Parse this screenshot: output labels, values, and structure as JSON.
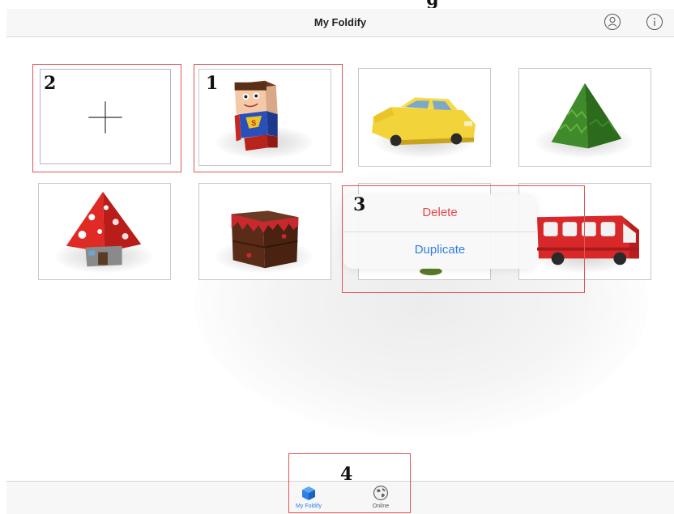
{
  "navbar": {
    "title": "My Foldify",
    "account_icon": "account-icon",
    "info_icon": "info-icon"
  },
  "grid": {
    "tiles": [
      {
        "name": "new-model",
        "icon": "plus-icon"
      },
      {
        "name": "superhero",
        "icon": "superhero-figure"
      },
      {
        "name": "car",
        "icon": "yellow-car"
      },
      {
        "name": "tree",
        "icon": "green-pyramid-tree"
      },
      {
        "name": "mushroom",
        "icon": "red-mushroom-house"
      },
      {
        "name": "cake",
        "icon": "chocolate-cake-cube"
      },
      {
        "name": "hidden-model",
        "icon": "partially-hidden-model"
      },
      {
        "name": "bus",
        "icon": "red-bus"
      }
    ]
  },
  "context_menu": {
    "delete_label": "Delete",
    "duplicate_label": "Duplicate"
  },
  "annotations": {
    "labels": [
      "1",
      "2",
      "3",
      "4"
    ]
  },
  "tabbar": {
    "tabs": [
      {
        "label": "My Foldify",
        "icon": "cube-icon",
        "selected": true
      },
      {
        "label": "Online",
        "icon": "globe-icon",
        "selected": false
      }
    ]
  },
  "colors": {
    "accent": "#2f7fe4",
    "delete": "#e8464a",
    "callout": "#e05555"
  }
}
